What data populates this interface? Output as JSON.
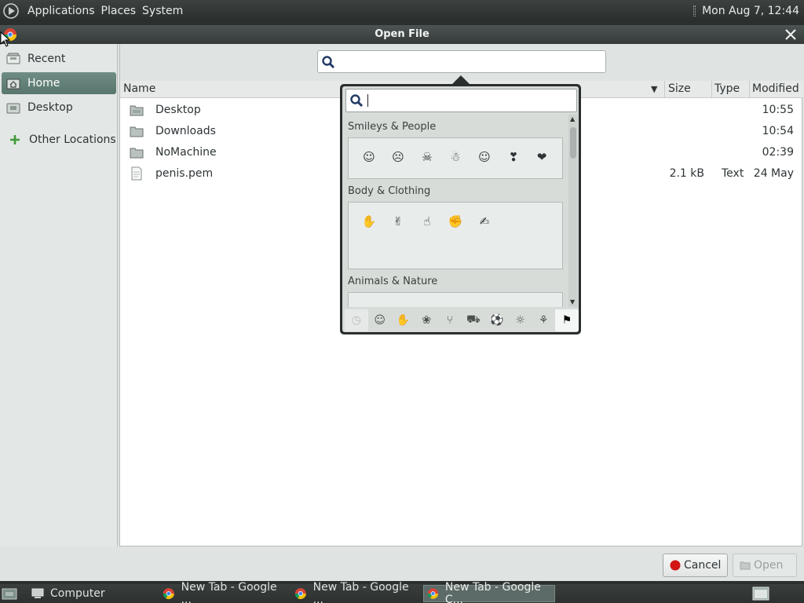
{
  "top_panel": {
    "menus": [
      "Applications",
      "Places",
      "System"
    ],
    "clock": "Mon Aug 7, 12:44"
  },
  "dialog": {
    "title": "Open File"
  },
  "sidebar": {
    "items": [
      {
        "label": "Recent",
        "icon": "recent-icon"
      },
      {
        "label": "Home",
        "icon": "home-icon"
      },
      {
        "label": "Desktop",
        "icon": "desktop-icon"
      },
      {
        "label": "Other Locations",
        "icon": "plus-icon"
      }
    ],
    "active_index": 1
  },
  "search": {
    "placeholder": ""
  },
  "columns": {
    "name": "Name",
    "size": "Size",
    "type": "Type",
    "modified": "Modified"
  },
  "files": [
    {
      "name": "Desktop",
      "size": "",
      "type": "",
      "modified": "10:55",
      "icon": "folder-icon"
    },
    {
      "name": "Downloads",
      "size": "",
      "type": "",
      "modified": "10:54",
      "icon": "folder-icon"
    },
    {
      "name": "NoMachine",
      "size": "",
      "type": "",
      "modified": "02:39",
      "icon": "folder-icon"
    },
    {
      "name": "penis.pem",
      "size": "2.1 kB",
      "type": "Text",
      "modified": "24 May",
      "icon": "file-icon"
    }
  ],
  "emoji_picker": {
    "search_value": "",
    "sections": [
      {
        "label": "Smileys & People",
        "emojis": [
          "☺",
          "☹",
          "☠",
          "☃",
          "☺",
          "❣",
          "❤"
        ]
      },
      {
        "label": "Body & Clothing",
        "emojis": [
          "✋",
          "✌",
          "☝",
          "✊",
          "✍"
        ]
      },
      {
        "label": "Animals & Nature",
        "emojis": []
      }
    ],
    "categories": [
      "recent",
      "smileys",
      "body",
      "nature",
      "food",
      "travel",
      "activities",
      "objects",
      "symbols",
      "flags"
    ],
    "active_category": 9
  },
  "buttons": {
    "cancel": "Cancel",
    "open": "Open"
  },
  "taskbar": {
    "tasks": [
      {
        "label": "Computer",
        "icon": "computer-icon"
      },
      {
        "label": "New Tab - Google ...",
        "icon": "chrome-icon"
      },
      {
        "label": "New Tab - Google ...",
        "icon": "chrome-icon"
      },
      {
        "label": "New Tab - Google C...",
        "icon": "chrome-icon"
      }
    ],
    "active_index": 3
  },
  "colors": {
    "accent": "#5f7d74",
    "panel": "#2b2f2e",
    "dialog_bg": "#dfe3e1"
  }
}
